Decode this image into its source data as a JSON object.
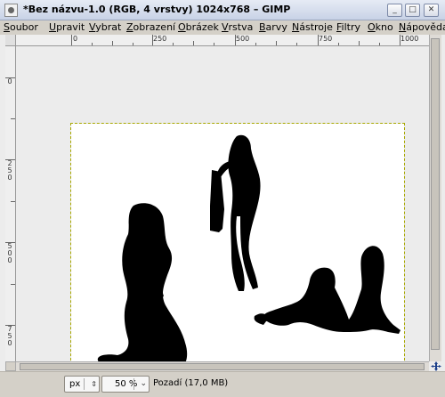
{
  "window": {
    "title": "*Bez názvu-1.0 (RGB, 4 vrstvy) 1024x768 – GIMP",
    "controls": [
      "_",
      "□",
      "✕"
    ]
  },
  "menubar": {
    "items": [
      {
        "label": "Soubor",
        "u": "S",
        "rest": "oubor"
      },
      {
        "label": "Upravit",
        "u": "U",
        "rest": "pravit"
      },
      {
        "label": "Vybrat",
        "u": "V",
        "rest": "ybrat"
      },
      {
        "label": "Zobrazení",
        "u": "Z",
        "rest": "obrazení"
      },
      {
        "label": "Obrázek",
        "u": "O",
        "rest": "brázek"
      },
      {
        "label": "Vrstva",
        "u": "V",
        "rest": "rstva"
      },
      {
        "label": "Barvy",
        "u": "B",
        "rest": "arvy"
      },
      {
        "label": "Nástroje",
        "u": "N",
        "rest": "ástroje"
      },
      {
        "label": "Filtry",
        "u": "F",
        "rest": "iltry"
      },
      {
        "label": "Okno",
        "u": "O",
        "rest": "kno"
      },
      {
        "label": "Nápověda",
        "u": "N",
        "rest": "ápověda"
      }
    ]
  },
  "rulers": {
    "horizontal": [
      "0",
      "250",
      "500",
      "750",
      "1000"
    ],
    "vertical": [
      "0",
      "2\n5\n0",
      "5\n0\n0",
      "7\n5\n0"
    ]
  },
  "statusbar": {
    "unit": "px",
    "zoom": "50 %",
    "layer_info": "Pozadí (17,0 MB)"
  }
}
